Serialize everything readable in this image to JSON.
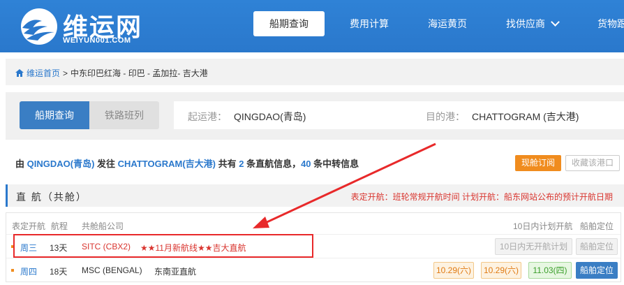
{
  "header": {
    "logo_text": "维运网",
    "logo_sub": "WEIYUN001.COM",
    "nav": [
      {
        "label": "船期查询"
      },
      {
        "label": "费用计算"
      },
      {
        "label": "海运黄页"
      },
      {
        "label": "找供应商"
      },
      {
        "label": "货物跟"
      }
    ]
  },
  "breadcrumb": {
    "home": "维运首页",
    "sep": ">",
    "path": "中东印巴红海 - 印巴 - 孟加拉- 吉大港"
  },
  "search": {
    "tabs": [
      "船期查询",
      "铁路班列"
    ],
    "origin_label": "起运港：",
    "origin_value": "QINGDAO(青岛)",
    "dest_label": "目的港：",
    "dest_value": "CHATTOGRAM (吉大港)"
  },
  "summary": {
    "p1": "由 ",
    "origin": "QINGDAO(青岛)",
    "p2": " 发往 ",
    "dest": "CHATTOGRAM(吉大港)",
    "p3": " 共有 ",
    "direct_count": "2",
    "p4": " 条直航信息，",
    "transfer_count": "40",
    "p5": " 条中转信息"
  },
  "buttons": {
    "subscribe": "现舱订阅",
    "favorite": "收藏该港口"
  },
  "section": {
    "title": "直 航（共舱）",
    "legend": "表定开航：班轮常规开航时间    计划开航：船东网站公布的预计开航日期"
  },
  "table": {
    "headers": {
      "sched": "表定开航",
      "transit": "航程",
      "carrier": "共舱船公司",
      "plan": "10日内计划开航",
      "locate": "船舶定位"
    },
    "rows": [
      {
        "day": "周三",
        "transit": "13天",
        "carrier": "SITC (CBX2)",
        "note": "★★11月新航线★★吉大直航",
        "plan_none": "10日内无开航计划",
        "locate": "船舶定位"
      },
      {
        "day": "周四",
        "transit": "18天",
        "carrier": "MSC (BENGAL)",
        "note": "东南亚直航",
        "dates": [
          "10.29(六)",
          "10.29(六)",
          "11.03(四)"
        ],
        "locate": "船舶定位"
      }
    ]
  }
}
